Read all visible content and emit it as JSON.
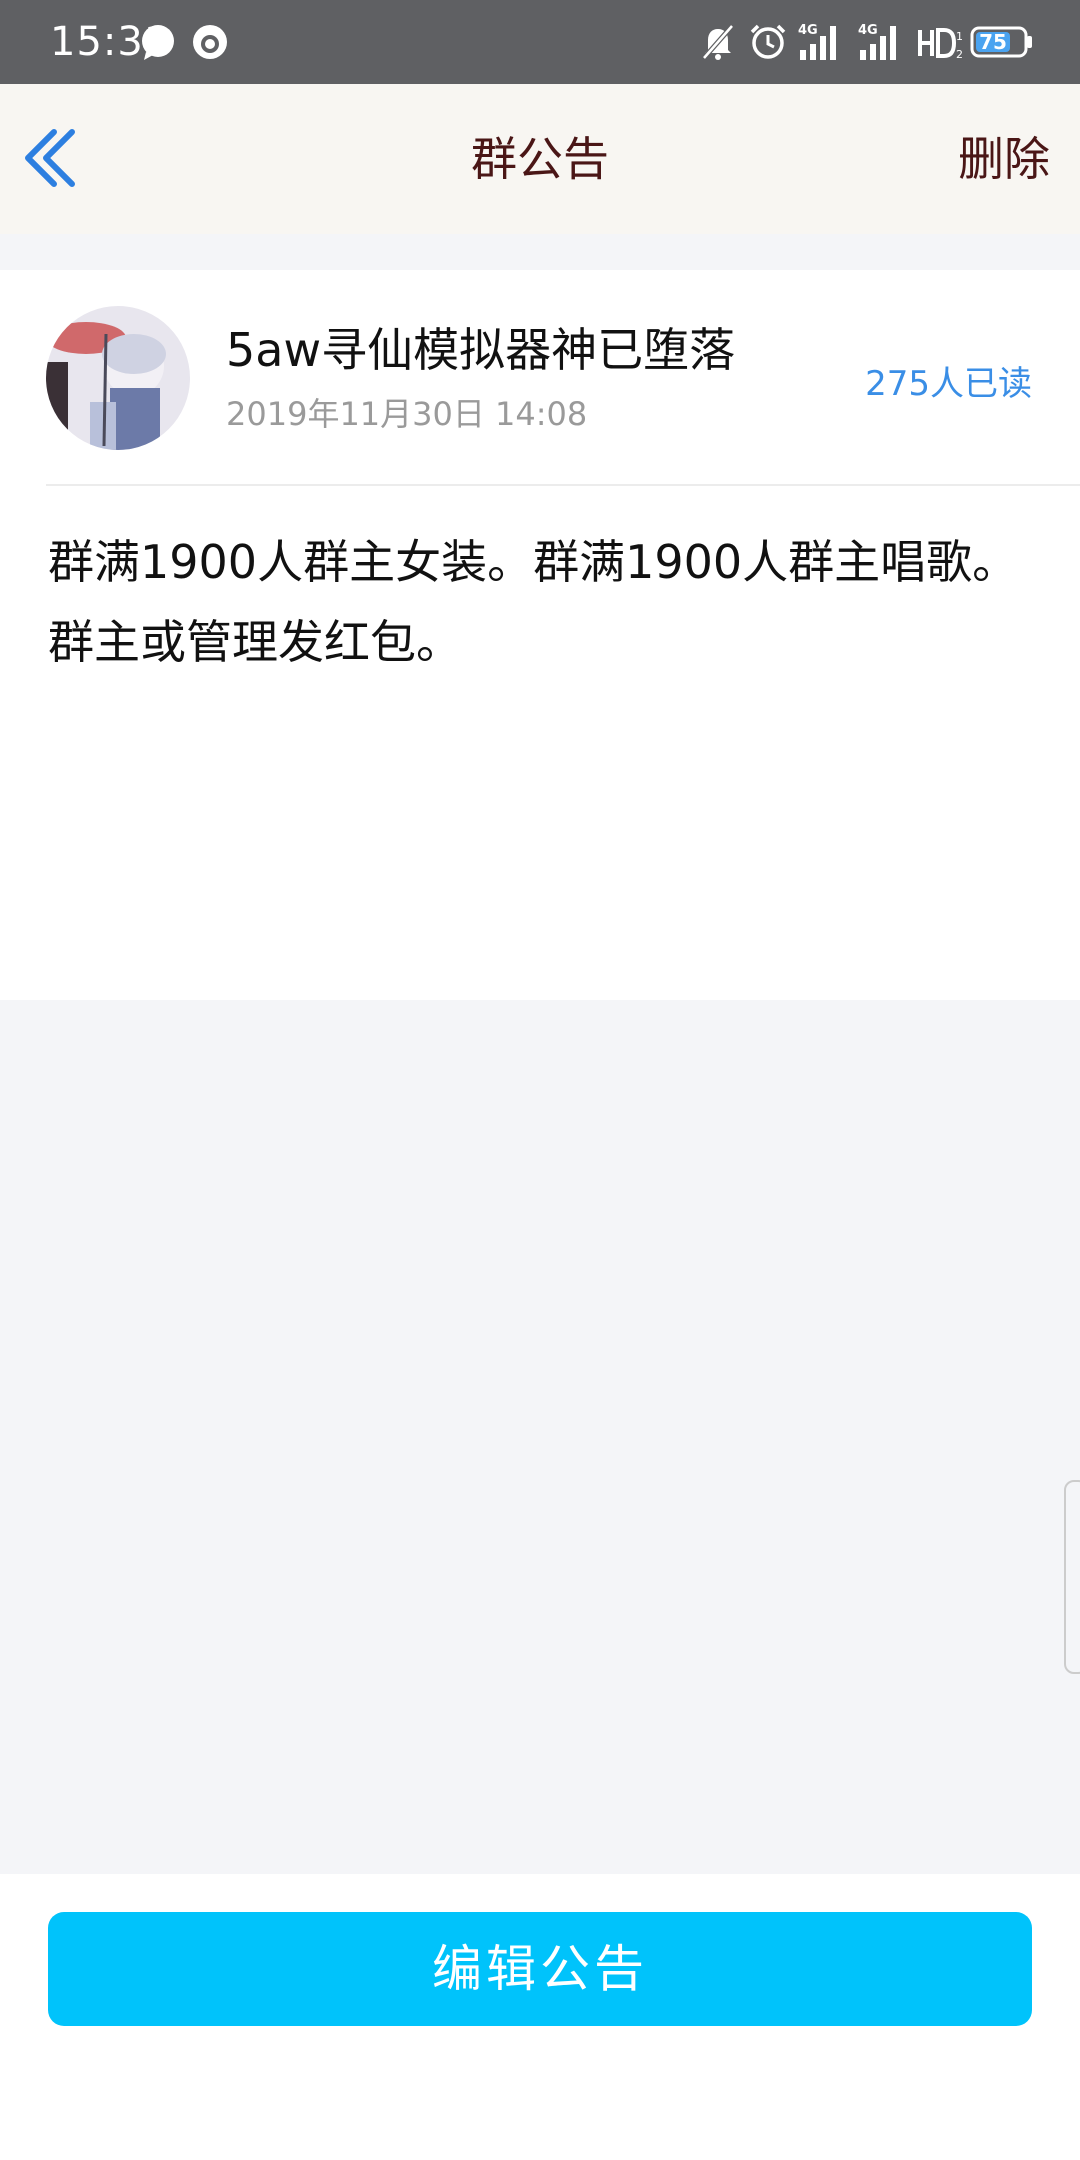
{
  "status_bar": {
    "time": "15:31",
    "battery_level": "75",
    "network_1": "4G",
    "network_2": "4G"
  },
  "header": {
    "title": "群公告",
    "delete_label": "删除",
    "back_icon": "double-chevron-left-icon"
  },
  "notice": {
    "author": "5aw寻仙模拟器神已堕落",
    "timestamp": "2019年11月30日 14:08",
    "read_count": "275人已读",
    "content": "群满1900人群主女装。群满1900人群主唱歌。群主或管理发红包。"
  },
  "footer": {
    "edit_label": "编辑公告"
  },
  "colors": {
    "status_bar_bg": "#5f6063",
    "header_bg": "#f8f6f2",
    "accent_blue": "#3a8ee6",
    "button_bg": "#00c3fb",
    "title_color": "#4a1616"
  }
}
